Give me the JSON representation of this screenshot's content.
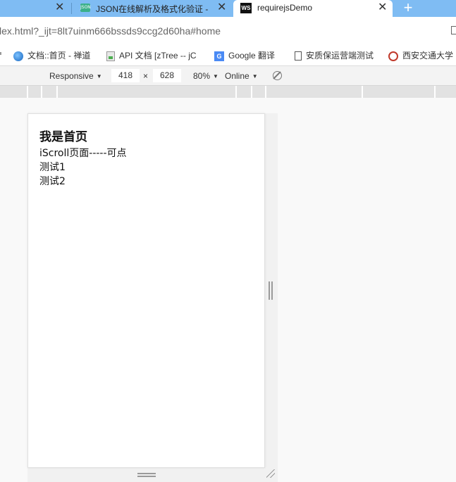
{
  "browser": {
    "tabs": [
      {
        "title": "",
        "favicon": "none"
      },
      {
        "title": "JSON在线解析及格式化验证 -",
        "favicon": "json-icon"
      },
      {
        "title": "requirejsDemo",
        "favicon": "webstorm-icon",
        "active": true
      }
    ],
    "close_glyph": "✕",
    "newtab_glyph": "+",
    "url": "lex.html?_ijt=8lt7uinm666bssds9ccg2d60ha#home",
    "bookmarks": [
      {
        "label": "文档::首页 - 禅道",
        "icon": "globe-icon"
      },
      {
        "label": "API 文档 [zTree -- jC",
        "icon": "sheet-icon"
      },
      {
        "label": "Google 翻译",
        "icon": "google-translate-icon"
      },
      {
        "label": "安质保运营端测试",
        "icon": "document-icon"
      },
      {
        "label": "西安交通大学",
        "icon": "seal-icon"
      }
    ]
  },
  "device_toolbar": {
    "device": "Responsive",
    "width": "418",
    "times": "×",
    "height": "628",
    "zoom": "80%",
    "throttle": "Online"
  },
  "page": {
    "heading": "我是首页",
    "lines": [
      "iScroll页面-----可点",
      "测试1",
      "测试2"
    ]
  },
  "colors": {
    "tabstrip": "#7fbcf3",
    "active_tab": "#ffffff",
    "viewport_bg": "#f9f9f9"
  }
}
